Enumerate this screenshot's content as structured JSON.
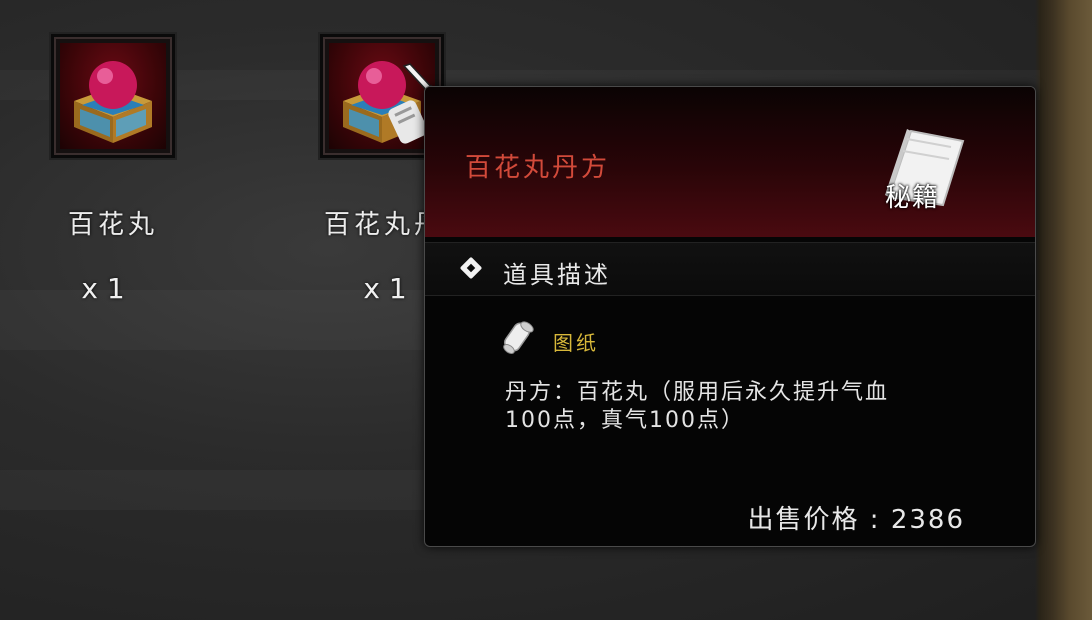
{
  "inventory": [
    {
      "name": "百花丸",
      "quantity": "x 1",
      "icon": "pill-box-icon"
    },
    {
      "name": "百花丸丹",
      "quantity": "x 1",
      "icon": "recipe-pill-box-icon"
    }
  ],
  "tooltip": {
    "title": "百花丸丹方",
    "category_badge": "秘籍",
    "section_label": "道具描述",
    "type_label": "图纸",
    "description_line1": "丹方：百花丸（服用后永久提升气血",
    "description_line2": "100点，真气100点）",
    "price_label": "出售价格",
    "price_separator": " : ",
    "price_value": "2386"
  },
  "colors": {
    "title_red": "#d24a3a",
    "type_gold": "#d8b83a",
    "header_red": "#4a0a10"
  }
}
